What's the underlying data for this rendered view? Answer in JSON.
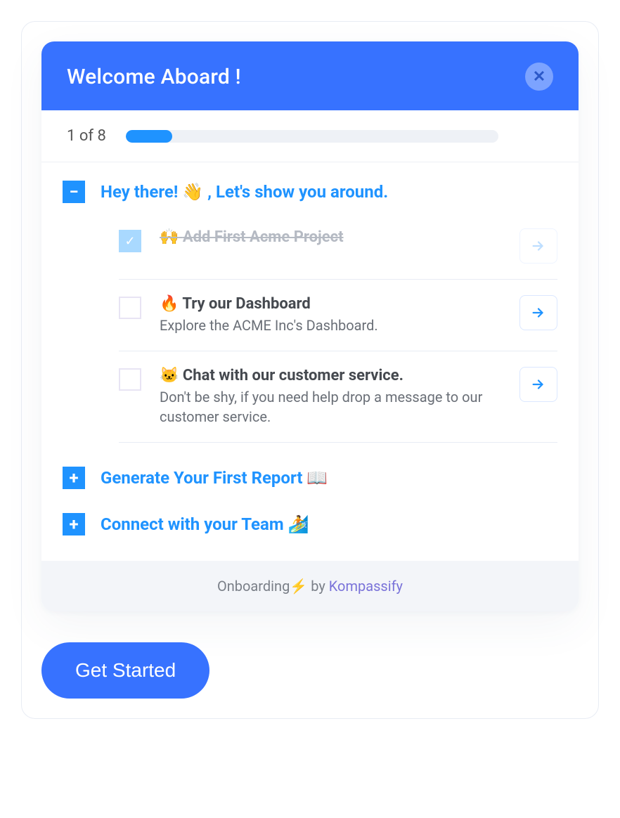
{
  "header": {
    "title": "Welcome Aboard !"
  },
  "progress": {
    "label": "1 of 8",
    "percent": 12.5
  },
  "sections": {
    "active": {
      "title": "Hey there! 👋 , Let's show you around.",
      "tasks": [
        {
          "emoji": "🙌",
          "title": "Add First Acme Project",
          "desc": "",
          "done": true
        },
        {
          "emoji": "🔥",
          "title": "Try our Dashboard",
          "desc": "Explore the ACME Inc's Dashboard.",
          "done": false
        },
        {
          "emoji": "🐱",
          "title": "Chat with our customer service.",
          "desc": "Don't be shy, if you need help drop a message to our customer service.",
          "done": false
        }
      ]
    },
    "collapsed": [
      {
        "title": "Generate Your First Report 📖"
      },
      {
        "title": "Connect with your Team 🏄"
      }
    ]
  },
  "footer": {
    "prefix": "Onboarding",
    "bolt": "⚡",
    "by": " by ",
    "brand": "Kompassify"
  },
  "cta": {
    "label": "Get Started"
  }
}
